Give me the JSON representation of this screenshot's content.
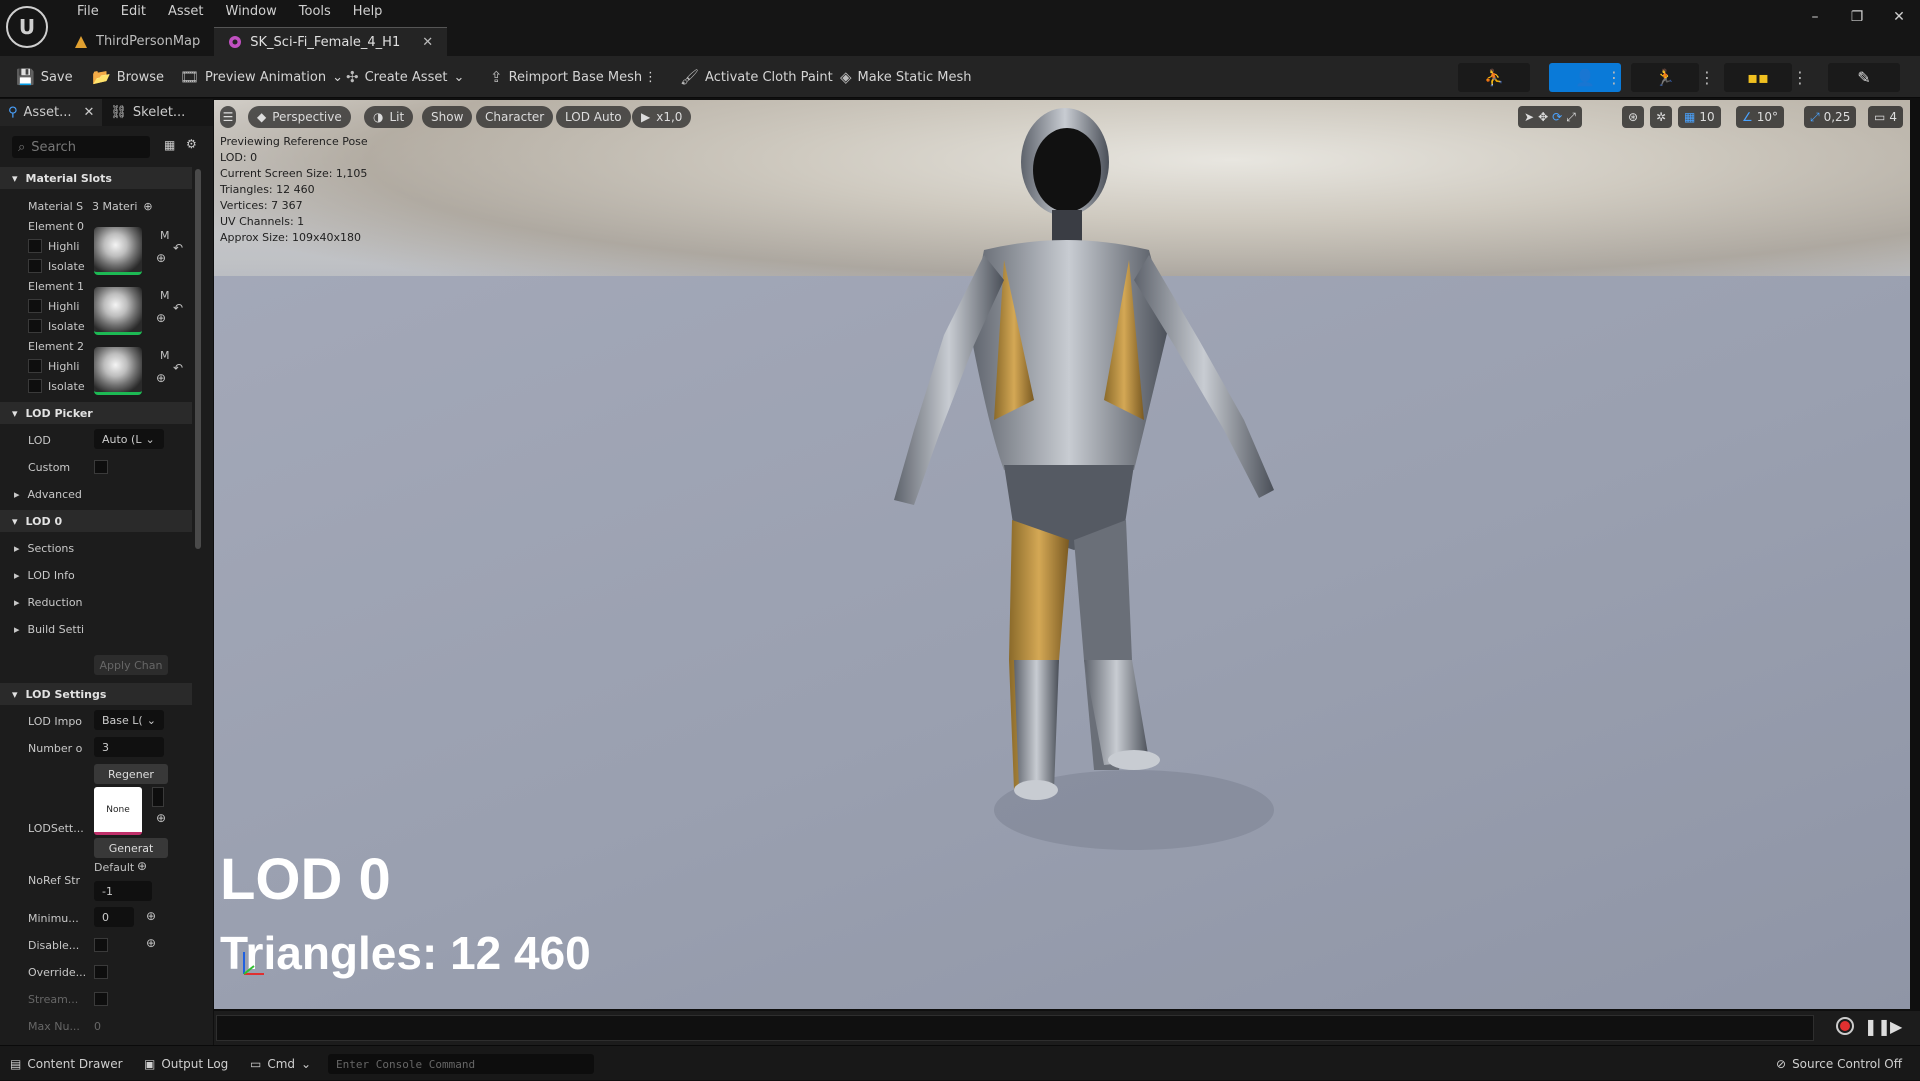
{
  "app": {
    "logo": "U"
  },
  "menu": [
    "File",
    "Edit",
    "Asset",
    "Window",
    "Tools",
    "Help"
  ],
  "tabs": [
    {
      "label": "ThirdPersonMap"
    },
    {
      "label": "SK_Sci-Fi_Female_4_H1"
    }
  ],
  "window_controls": {
    "minimize": "–",
    "restore": "❐",
    "close": "✕"
  },
  "toolbar": {
    "save": "Save",
    "browse": "Browse",
    "preview_animation": "Preview Animation",
    "create_asset": "Create Asset",
    "reimport": "Reimport Base Mesh",
    "cloth_paint": "Activate Cloth Paint",
    "static_mesh": "Make Static Mesh"
  },
  "left_panel": {
    "tab_asset": "Asset...",
    "tab_skeleton": "Skelet...",
    "search_placeholder": "Search",
    "material_slots": "Material Slots",
    "material_s": "Material S",
    "material_count": "3 Materi",
    "elements": [
      {
        "label": "Element 0"
      },
      {
        "label": "Element 1"
      },
      {
        "label": "Element 2"
      }
    ],
    "highlight": "Highli",
    "isolate": "Isolate",
    "m": "M",
    "lod_picker": "LOD Picker",
    "lod": "LOD",
    "lod_value": "Auto (L",
    "custom": "Custom",
    "advanced": "Advanced",
    "lod0": "LOD 0",
    "sections": "Sections",
    "lod_info": "LOD Info",
    "reduction": "Reduction",
    "build_settings": "Build Setti",
    "apply_changes": "Apply Chan",
    "lod_settings": "LOD Settings",
    "lod_import": "LOD Impo",
    "lod_import_value": "Base L(",
    "number_of": "Number o",
    "number_value": "3",
    "regenerate": "Regener",
    "lodsett": "LODSett...",
    "none": "None",
    "generate": "Generat",
    "noref": "NoRef Str",
    "default": "Default",
    "noref_value": "-1",
    "minimum": "Minimu...",
    "minimum_value": "0",
    "disable": "Disable...",
    "override": "Override...",
    "stream": "Stream...",
    "maxnu": "Max Nu...",
    "maxnu_value": "0"
  },
  "viewport": {
    "perspective": "Perspective",
    "lit": "Lit",
    "show": "Show",
    "character": "Character",
    "lod_auto": "LOD Auto",
    "speed": "x1,0",
    "grid": "10",
    "angle": "10°",
    "scale": "0,25",
    "camera": "4",
    "stats": [
      "Previewing Reference Pose",
      "LOD: 0",
      "Current Screen Size: 1,105",
      "Triangles: 12 460",
      "Vertices: 7 367",
      "UV Channels: 1",
      "Approx Size: 109x40x180"
    ],
    "lod_big": "LOD 0",
    "triangles_big": "Triangles: 12 460"
  },
  "statusbar": {
    "content_drawer": "Content Drawer",
    "output_log": "Output Log",
    "cmd": "Cmd",
    "console_placeholder": "Enter Console Command",
    "source_control": "Source Control Off"
  }
}
